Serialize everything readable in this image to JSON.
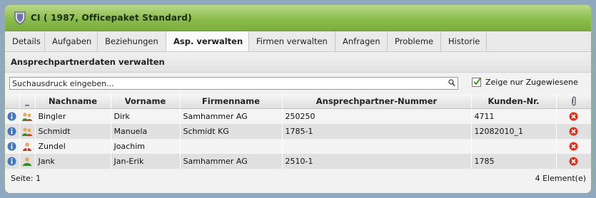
{
  "window": {
    "title": "CI ( 1987, Officepaket Standard)"
  },
  "tabs": [
    {
      "label": "Details"
    },
    {
      "label": "Aufgaben"
    },
    {
      "label": "Beziehungen"
    },
    {
      "label": "Asp. verwalten",
      "active": true
    },
    {
      "label": "Firmen verwalten"
    },
    {
      "label": "Anfragen"
    },
    {
      "label": "Probleme"
    },
    {
      "label": "Historie"
    }
  ],
  "section": {
    "title": "Ansprechpartnerdaten verwalten"
  },
  "search": {
    "placeholder": "Suchausdruck eingeben...",
    "value": ""
  },
  "filter": {
    "label": "Zeige nur Zugewiesene",
    "checked": true
  },
  "table": {
    "columns": [
      "",
      "_",
      "Nachname",
      "Vorname",
      "Firmenname",
      "Ansprechpartner-Nummer",
      "Kunden-Nr.",
      ""
    ],
    "rows": [
      {
        "nachname": "Bingler",
        "vorname": "Dirk",
        "firma": "Samhammer AG",
        "nummer": "250250",
        "kunde": "4711",
        "type_icon": "group-icon"
      },
      {
        "nachname": "Schmidt",
        "vorname": "Manuela",
        "firma": "Schmidt KG",
        "nummer": "1785-1",
        "kunde": "12082010_1",
        "type_icon": "group-icon"
      },
      {
        "nachname": "Zundel",
        "vorname": "Joachim",
        "firma": "",
        "nummer": "",
        "kunde": "",
        "type_icon": "contact-alert-icon"
      },
      {
        "nachname": "Jank",
        "vorname": "Jan-Erik",
        "firma": "Samhammer AG",
        "nummer": "2510-1",
        "kunde": "1785",
        "type_icon": "person-icon"
      }
    ]
  },
  "footer": {
    "page": "Seite: 1",
    "count": "4 Element(e)"
  },
  "colors": {
    "titlebar": "#8bbd4c",
    "info": "#3f74c6",
    "delete": "#d9341e"
  }
}
